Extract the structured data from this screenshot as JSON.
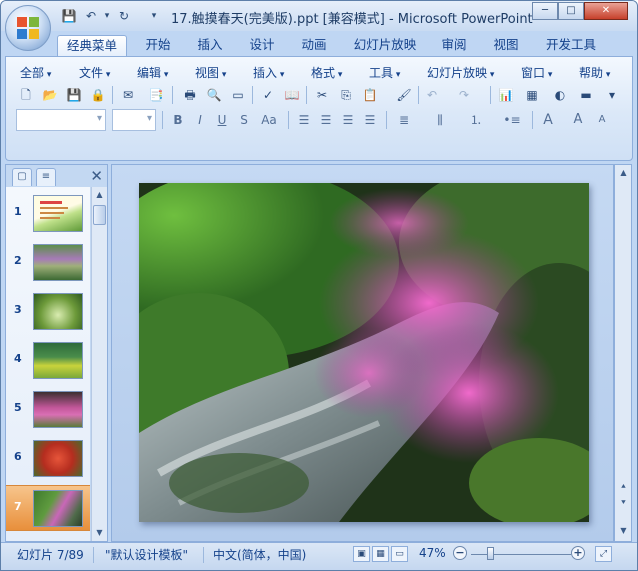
{
  "title": "17.触摸春天(完美版).ppt [兼容模式] - Microsoft PowerPoint",
  "window_controls": {
    "minimize": "─",
    "maximize": "□",
    "close": "✕"
  },
  "tabs": [
    "经典菜单",
    "开始",
    "插入",
    "设计",
    "动画",
    "幻灯片放映",
    "审阅",
    "视图",
    "开发工具"
  ],
  "active_tab": "经典菜单",
  "menus": [
    "全部",
    "文件",
    "编辑",
    "视图",
    "插入",
    "格式",
    "工具",
    "幻灯片放映",
    "窗口",
    "帮助"
  ],
  "toolbar_icons": [
    "new-icon",
    "open-icon",
    "save-icon",
    "permission-icon",
    "email-icon",
    "publish-icon",
    "print-icon",
    "print-preview-icon",
    "spell-icon",
    "research-icon",
    "cut-icon",
    "copy-icon",
    "paste-icon",
    "format-painter-icon",
    "undo-icon",
    "redo-icon",
    "chart-icon",
    "table-icon",
    "color-icon",
    "show-hide-icon"
  ],
  "format_buttons": [
    "B",
    "I",
    "U",
    "S",
    "Aa"
  ],
  "font_size_buttons": [
    "A",
    "A",
    "A"
  ],
  "slides_pane": {
    "tab_labels": [
      "▢",
      "≡"
    ],
    "close": "✕",
    "thumbnails": [
      {
        "number": "1"
      },
      {
        "number": "2"
      },
      {
        "number": "3"
      },
      {
        "number": "4"
      },
      {
        "number": "5"
      },
      {
        "number": "6"
      },
      {
        "number": "7"
      }
    ],
    "selected": "7"
  },
  "status": {
    "slide": "幻灯片 7/89",
    "template": "\"默认设计模板\"",
    "language": "中文(简体，中国)",
    "zoom": "47%",
    "zoom_level": 0.47
  },
  "colors": {
    "accent": "#15428b",
    "ribbon_bg": "#dbe8f8",
    "selected_thumb": "#e88f3b",
    "close_button": "#c7402b"
  }
}
